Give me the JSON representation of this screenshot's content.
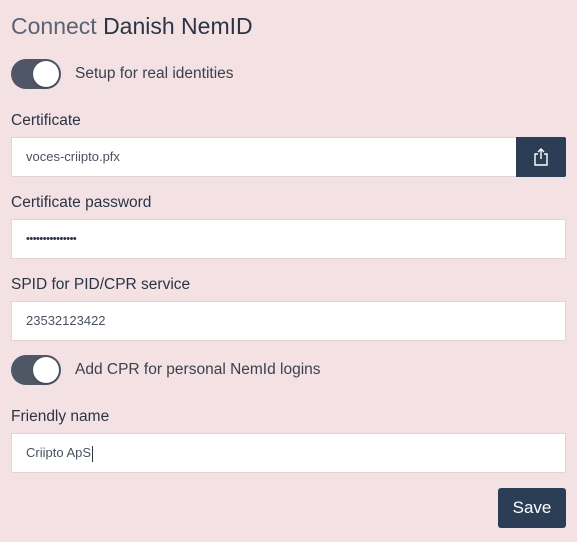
{
  "header": {
    "title_prefix": "Connect",
    "title_main": "Danish NemID"
  },
  "form": {
    "real_identities_toggle": {
      "label": "Setup for real identities",
      "on": true
    },
    "certificate": {
      "label": "Certificate",
      "value": "voces-criipto.pfx",
      "upload_icon": "share-upload-icon"
    },
    "certificate_password": {
      "label": "Certificate password",
      "value": "•••••••••••••••"
    },
    "spid": {
      "label": "SPID for PID/CPR service",
      "value": "23532123422"
    },
    "cpr_toggle": {
      "label": "Add CPR for personal NemId logins",
      "on": true
    },
    "friendly_name": {
      "label": "Friendly name",
      "value": "Criipto ApS"
    },
    "save_label": "Save"
  },
  "colors": {
    "background": "#f3e1e3",
    "primary": "#2c3e56",
    "toggle_track": "#4f5666"
  }
}
